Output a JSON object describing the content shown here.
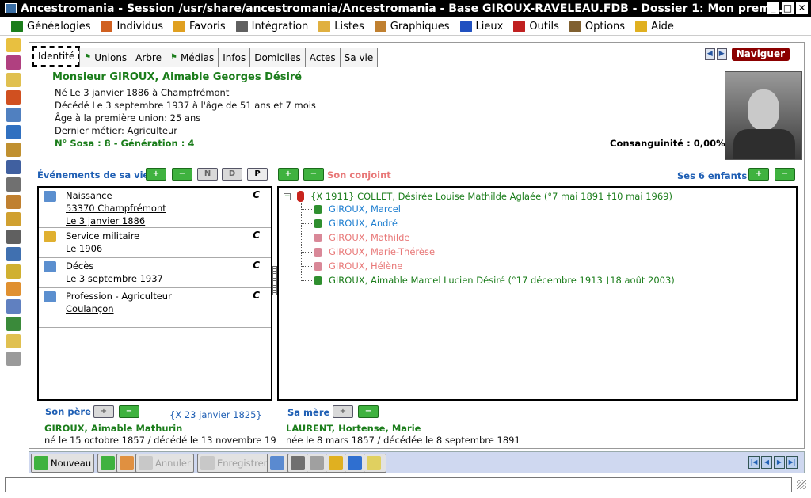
{
  "window": {
    "title": "Ancestromania - Session /usr/share/ancestromania/Ancestromania - Base GIROUX-RAVELEAU.FDB - Dossier 1: Mon premi..."
  },
  "menu": [
    {
      "label": "Généalogies",
      "icon": "tree-icon",
      "color": "#1b7d1b"
    },
    {
      "label": "Individus",
      "icon": "individuals-icon",
      "color": "#d06020"
    },
    {
      "label": "Favoris",
      "icon": "favorites-icon",
      "color": "#e0a020"
    },
    {
      "label": "Intégration",
      "icon": "database-icon",
      "color": "#606060"
    },
    {
      "label": "Listes",
      "icon": "folder-icon",
      "color": "#e0b040"
    },
    {
      "label": "Graphiques",
      "icon": "charts-icon",
      "color": "#c08030"
    },
    {
      "label": "Lieux",
      "icon": "flag-icon",
      "color": "#2050c0"
    },
    {
      "label": "Outils",
      "icon": "tools-icon",
      "color": "#c02020"
    },
    {
      "label": "Options",
      "icon": "options-icon",
      "color": "#806030"
    },
    {
      "label": "Aide",
      "icon": "help-icon",
      "color": "#e0b020"
    }
  ],
  "tabs": [
    "Identité",
    "Unions",
    "Arbre",
    "Médias",
    "Infos",
    "Domiciles",
    "Actes",
    "Sa vie"
  ],
  "navigate_label": "Naviguer",
  "person": {
    "name": "Monsieur GIROUX, Aimable Georges Désiré",
    "birth": "Né Le 3 janvier 1886 à Champfrémont",
    "death": "Décédé Le 3 septembre 1937 à l'âge de 51 ans et 7 mois",
    "first_union_age": "Âge à la première union: 25 ans",
    "last_job": "Dernier métier: Agriculteur",
    "sosa": "N° Sosa : 8 - Génération : 4",
    "consanguinity": "Consanguinité : 0,00%"
  },
  "events_header": "Événements de sa vie",
  "conjoint_label": "Son conjoint",
  "children_label": "Ses 6 enfants",
  "btn_letters": {
    "n": "N",
    "d": "D",
    "p": "P"
  },
  "events": [
    {
      "title": "Naissance",
      "lines": [
        "53370 Champfrémont",
        "Le 3 janvier 1886"
      ]
    },
    {
      "title": "Service militaire",
      "lines": [
        "Le 1906"
      ]
    },
    {
      "title": "Décès",
      "lines": [
        "Le 3 septembre 1937"
      ]
    },
    {
      "title": "Profession - Agriculteur",
      "lines": [
        " Coulançon"
      ]
    }
  ],
  "event_c": "C",
  "spouse": "{X 1911} COLLET, Désirée Louise Mathilde Aglaée (°7 mai 1891 †10 mai 1969)",
  "children": [
    {
      "name": "GIROUX, Marcel",
      "sex": "m",
      "color": "#1f7fd0"
    },
    {
      "name": "GIROUX, André",
      "sex": "m",
      "color": "#1f7fd0"
    },
    {
      "name": "GIROUX, Mathilde",
      "sex": "f",
      "color": "#e87878"
    },
    {
      "name": "GIROUX, Marie-Thérèse",
      "sex": "f",
      "color": "#e87878"
    },
    {
      "name": "GIROUX, Hélène",
      "sex": "f",
      "color": "#e87878"
    },
    {
      "name": "GIROUX, Aimable Marcel Lucien Désiré (°17 décembre 1913 †18 août 2003)",
      "sex": "m",
      "color": "#1b7d1b"
    }
  ],
  "father": {
    "label": "Son père",
    "union": "{X 23 janvier 1825}",
    "name": "GIROUX, Aimable Mathurin",
    "dates": "né le 15 octobre 1857 / décédé le 13 novembre 19"
  },
  "mother": {
    "label": "Sa mère",
    "name": "LAURENT, Hortense, Marie",
    "dates": "née le 8 mars 1857 / décédée le 8 septembre 1891"
  },
  "toolbar": {
    "new_label": "Nouveau",
    "cancel_label": "Annuler",
    "save_label": "Enregistrer"
  }
}
